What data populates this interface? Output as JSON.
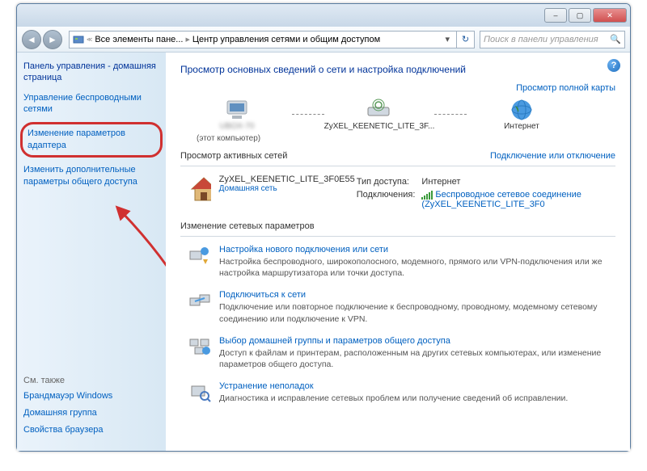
{
  "titlebar": {
    "min": "–",
    "max": "▢",
    "close": "✕"
  },
  "address": {
    "seg1": "Все элементы пане...",
    "seg2": "Центр управления сетями и общим доступом"
  },
  "search": {
    "placeholder": "Поиск в панели управления"
  },
  "sidebar": {
    "heading": "Панель управления - домашняя страница",
    "link1": "Управление беспроводными сетями",
    "link2": "Изменение параметров адаптера",
    "link3": "Изменить дополнительные параметры общего доступа",
    "see_also": "См. также",
    "sa1": "Брандмауэр Windows",
    "sa2": "Домашняя группа",
    "sa3": "Свойства браузера"
  },
  "main": {
    "title": "Просмотр основных сведений о сети и настройка подключений",
    "full_map": "Просмотр полной карты",
    "node1": "(этот компьютер)",
    "node2": "ZyXEL_KEENETIC_LITE_3F...",
    "node3": "Интернет",
    "active_nets": "Просмотр активных сетей",
    "connect_disconnect": "Подключение или отключение",
    "net_name": "ZyXEL_KEENETIC_LITE_3F0E55",
    "net_type": "Домашняя сеть",
    "access_label": "Тип доступа:",
    "access_value": "Интернет",
    "conn_label": "Подключения:",
    "conn_value": "Беспроводное сетевое соединение (ZyXEL_KEENETIC_LITE_3F0",
    "change_title": "Изменение сетевых параметров",
    "tasks": [
      {
        "title": "Настройка нового подключения или сети",
        "desc": "Настройка беспроводного, широкополосного, модемного, прямого или VPN-подключения или же настройка маршрутизатора или точки доступа."
      },
      {
        "title": "Подключиться к сети",
        "desc": "Подключение или повторное подключение к беспроводному, проводному, модемному сетевому соединению или подключение к VPN."
      },
      {
        "title": "Выбор домашней группы и параметров общего доступа",
        "desc": "Доступ к файлам и принтерам, расположенным на других сетевых компьютерах, или изменение параметров общего доступа."
      },
      {
        "title": "Устранение неполадок",
        "desc": "Диагностика и исправление сетевых проблем или получение сведений об исправлении."
      }
    ]
  }
}
